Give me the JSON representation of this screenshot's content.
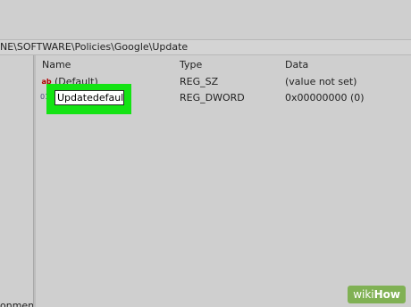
{
  "address_bar": {
    "path": "NE\\SOFTWARE\\Policies\\Google\\Update"
  },
  "left_pane": {
    "partial_label": "onment"
  },
  "columns": {
    "name": "Name",
    "type": "Type",
    "data": "Data"
  },
  "rows": [
    {
      "icon": "string-value-icon",
      "icon_glyph": "ab",
      "name": "(Default)",
      "type": "REG_SZ",
      "data": "(value not set)"
    },
    {
      "icon": "dword-value-icon",
      "icon_glyph": "011",
      "name": "Updatedefault",
      "type": "REG_DWORD",
      "data": "0x00000000 (0)"
    }
  ],
  "rename_field": {
    "value": "Updatedefault"
  },
  "watermark": {
    "wiki": "wiki",
    "how": "How"
  },
  "colors": {
    "highlight": "#14e314",
    "watermark_bg": "#7aaf4a"
  }
}
